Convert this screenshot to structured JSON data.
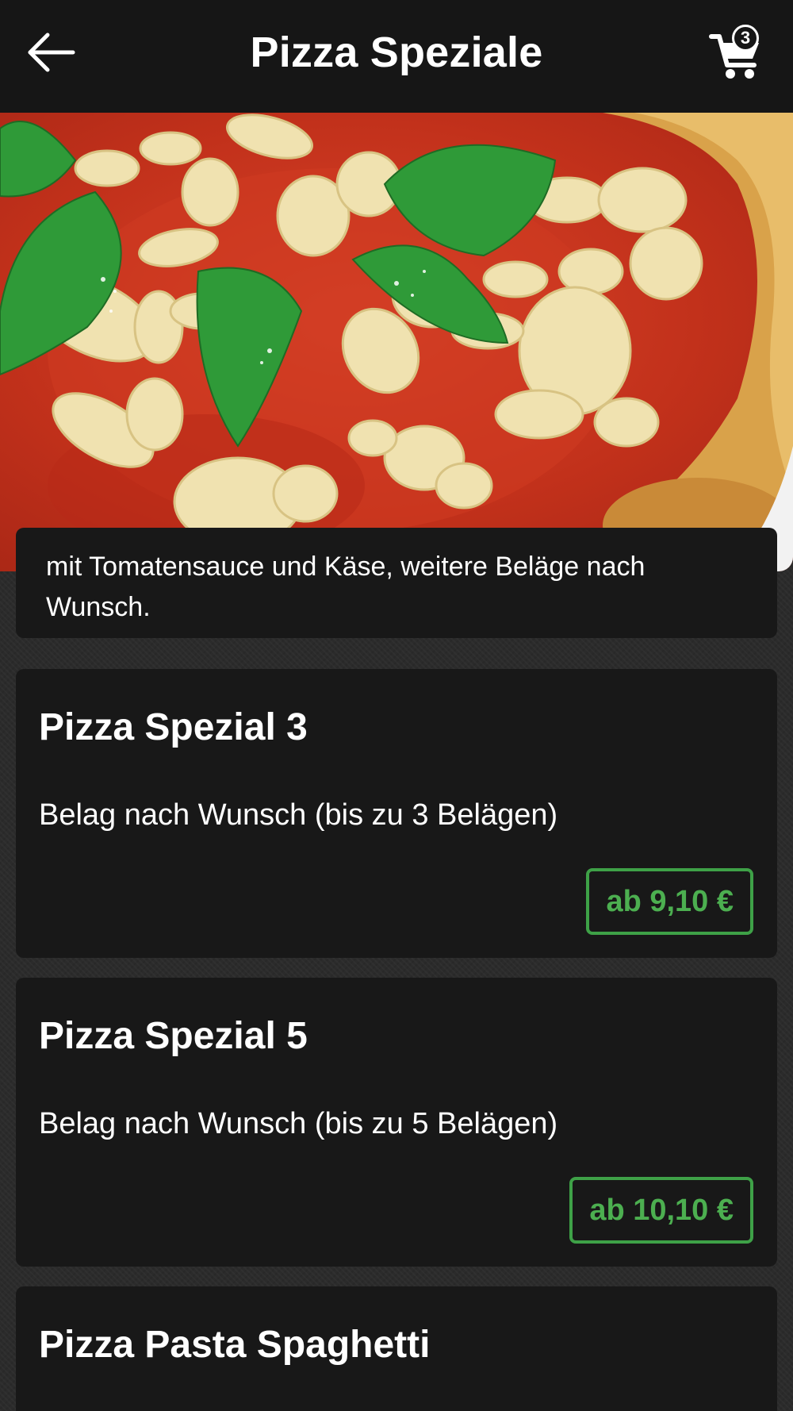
{
  "header": {
    "title": "Pizza Speziale",
    "back_icon": "arrow-left-icon",
    "cart_icon": "shopping-cart-icon",
    "cart_count": "3"
  },
  "hero": {
    "image_subject": "pizza-photo"
  },
  "category": {
    "description": "mit Tomatensauce und Käse, weitere Beläge nach Wunsch."
  },
  "products": [
    {
      "name": "Pizza Spezial 3",
      "description": "Belag nach Wunsch (bis zu 3 Belägen)",
      "price": "ab 9,10 €"
    },
    {
      "name": "Pizza Spezial 5",
      "description": "Belag nach Wunsch (bis zu 5 Belägen)",
      "price": "ab 10,10 €"
    },
    {
      "name": "Pizza Pasta Spaghetti"
    }
  ],
  "colors": {
    "header_bg": "#161616",
    "card_bg": "#181818",
    "page_bg": "#2b2b2b",
    "price_accent": "#4caf50"
  }
}
